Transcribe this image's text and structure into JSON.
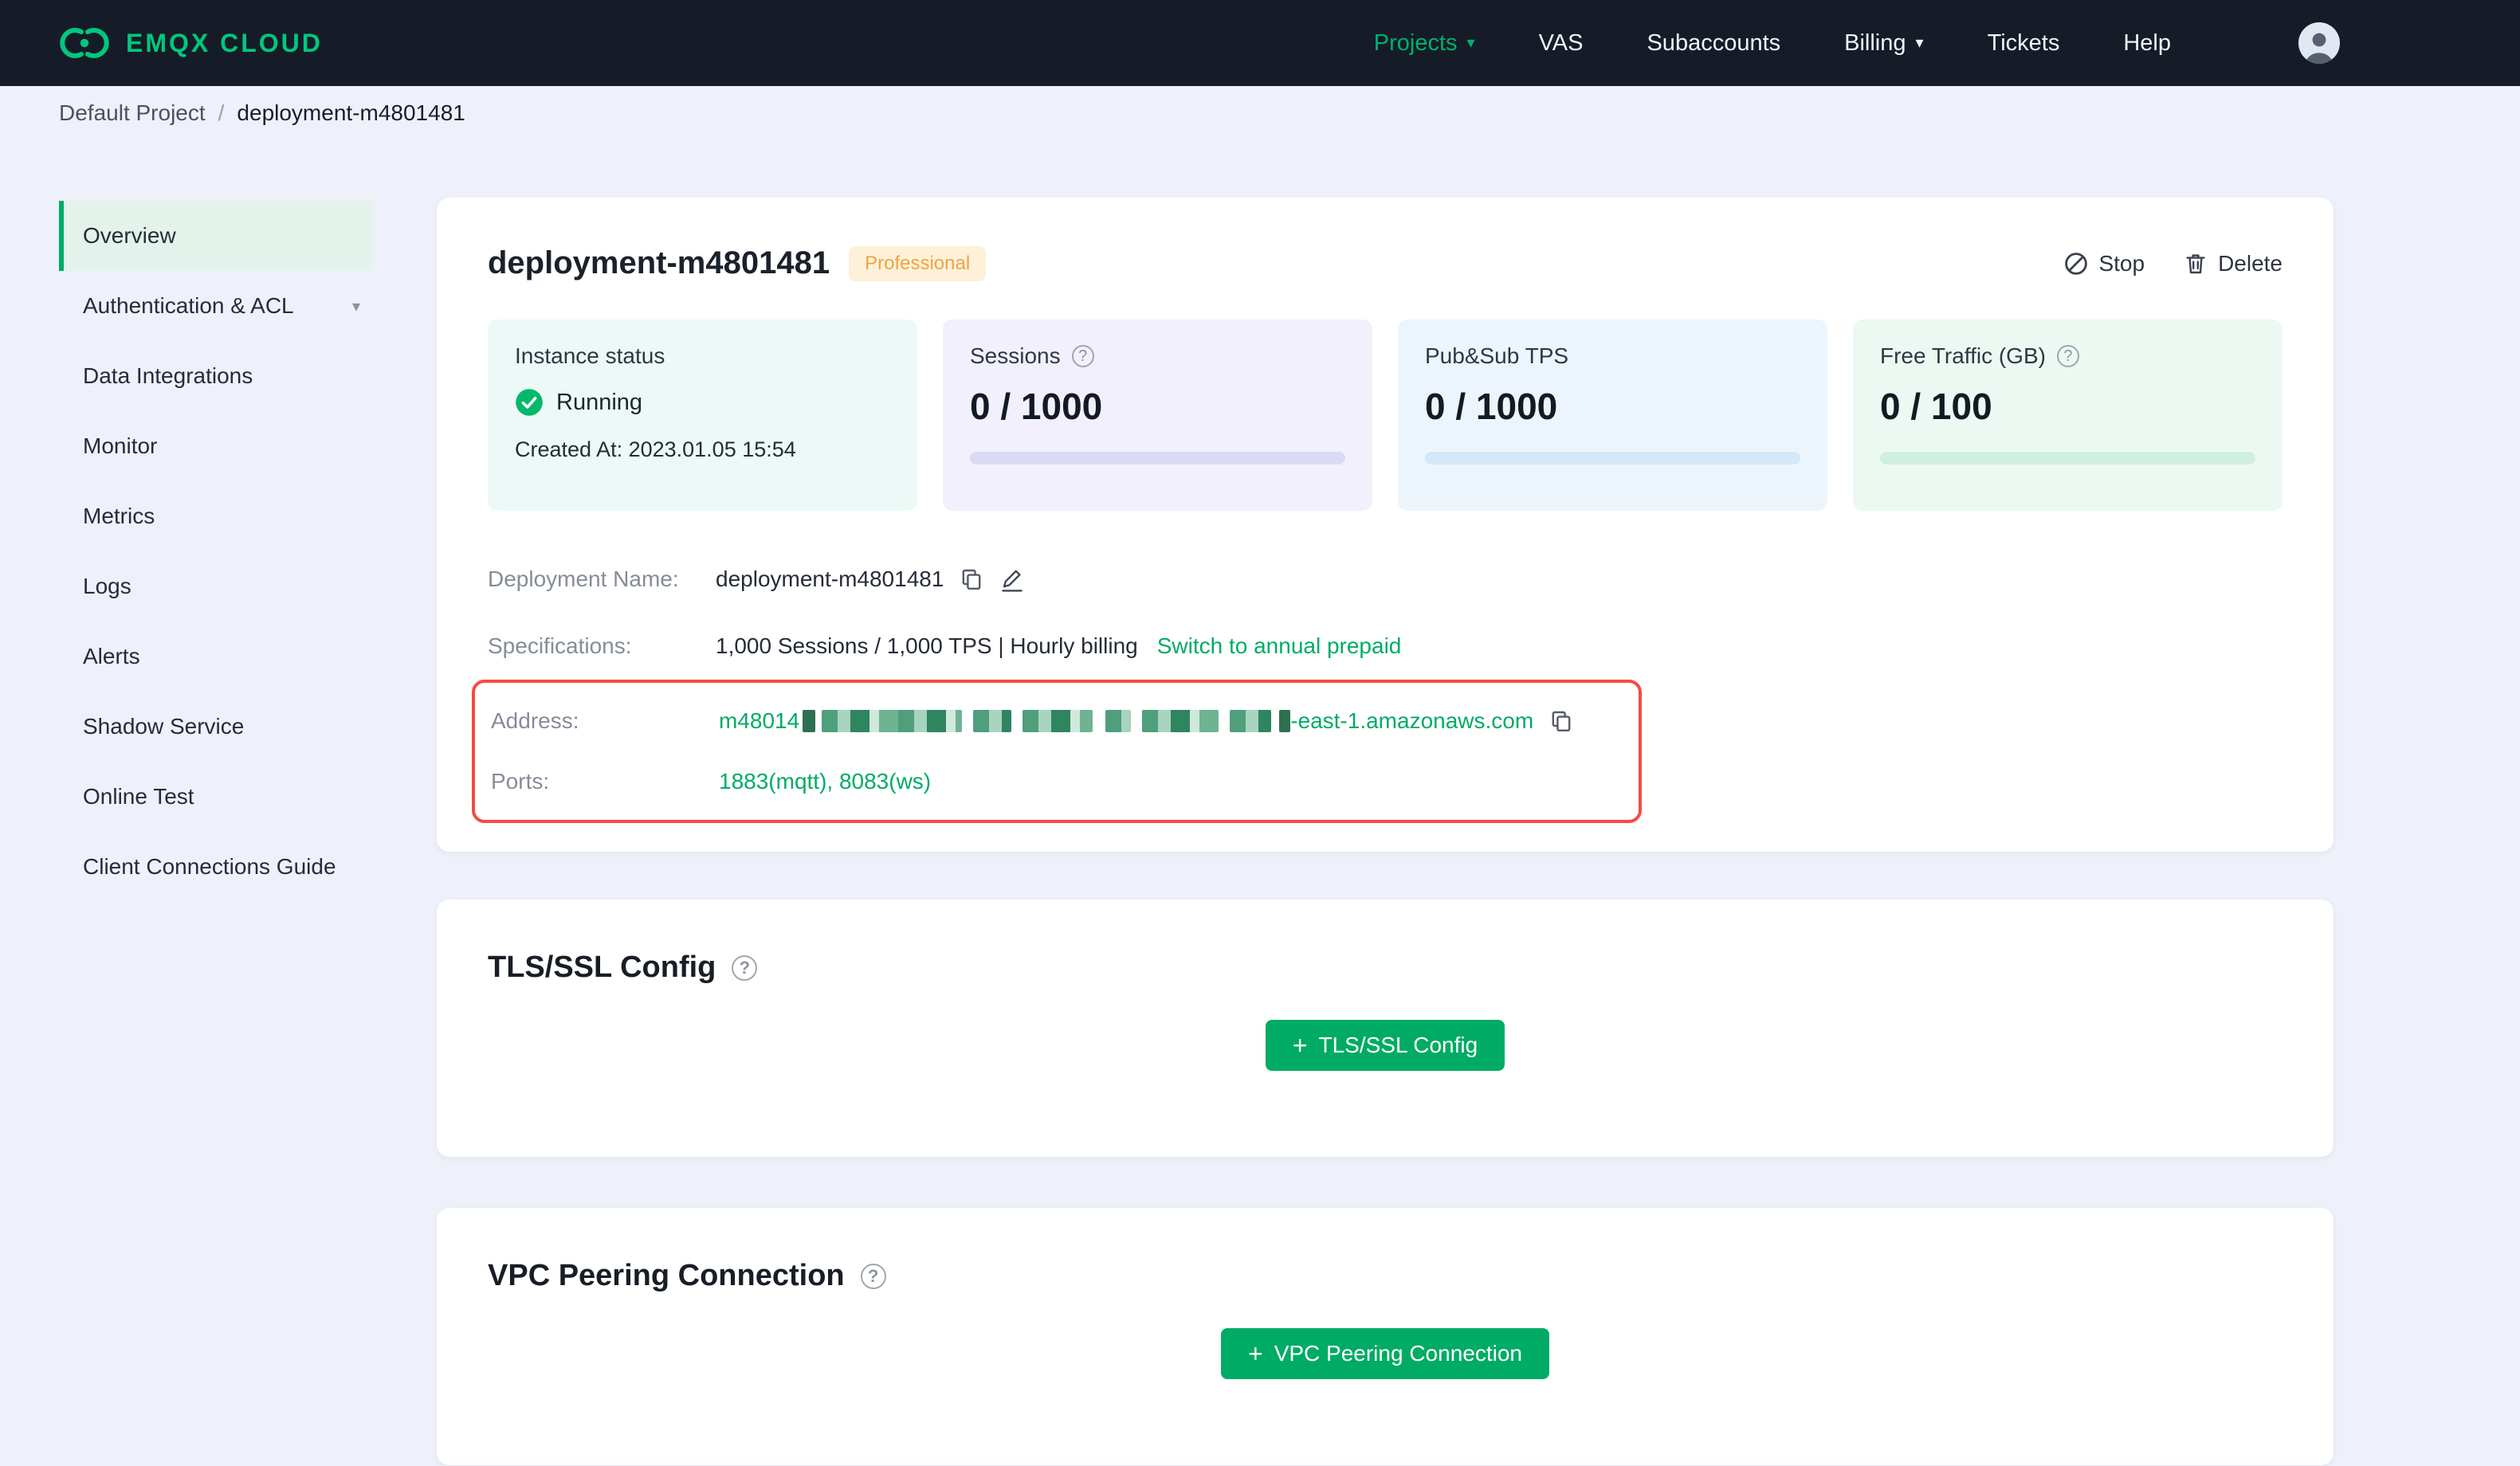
{
  "nav": {
    "brand": "EMQX CLOUD",
    "projects": "Projects",
    "vas": "VAS",
    "subaccounts": "Subaccounts",
    "billing": "Billing",
    "tickets": "Tickets",
    "help": "Help"
  },
  "breadcrumb": {
    "project": "Default Project",
    "separator": "/",
    "current": "deployment-m4801481"
  },
  "sidebar": {
    "items": [
      "Overview",
      "Authentication & ACL",
      "Data Integrations",
      "Monitor",
      "Metrics",
      "Logs",
      "Alerts",
      "Shadow Service",
      "Online Test",
      "Client Connections Guide"
    ]
  },
  "deployment": {
    "title": "deployment-m4801481",
    "badge": "Professional",
    "actions": {
      "stop": "Stop",
      "delete": "Delete"
    },
    "stats": {
      "instance": {
        "label": "Instance status",
        "status": "Running",
        "created": "Created At: 2023.01.05 15:54"
      },
      "sessions": {
        "label": "Sessions",
        "value": "0 / 1000"
      },
      "tps": {
        "label": "Pub&Sub TPS",
        "value": "0 / 1000"
      },
      "traffic": {
        "label": "Free Traffic (GB)",
        "value": "0 / 100"
      }
    },
    "details": {
      "name_label": "Deployment Name:",
      "name_value": "deployment-m4801481",
      "spec_label": "Specifications:",
      "spec_value": "1,000 Sessions / 1,000 TPS | Hourly billing",
      "spec_link": "Switch to annual prepaid",
      "address_label": "Address:",
      "address_prefix": "m48014",
      "address_suffix": "-east-1.amazonaws.com",
      "ports_label": "Ports:",
      "ports_value": "1883(mqtt), 8083(ws)"
    }
  },
  "tls": {
    "title": "TLS/SSL Config",
    "button_label": "TLS/SSL Config"
  },
  "vpc": {
    "title": "VPC Peering Connection",
    "button_label": "VPC Peering Connection"
  },
  "icons": {
    "help": "?",
    "caret": "▾",
    "plus": "+"
  },
  "colors": {
    "accent_green": "#00ab66",
    "logo_green": "#00c87d",
    "running_green": "#00b96b",
    "highlight_red": "#f54b45",
    "badge_orange": "#efa43e",
    "topnav_bg": "#151c28",
    "page_bg": "#eef1f9"
  }
}
